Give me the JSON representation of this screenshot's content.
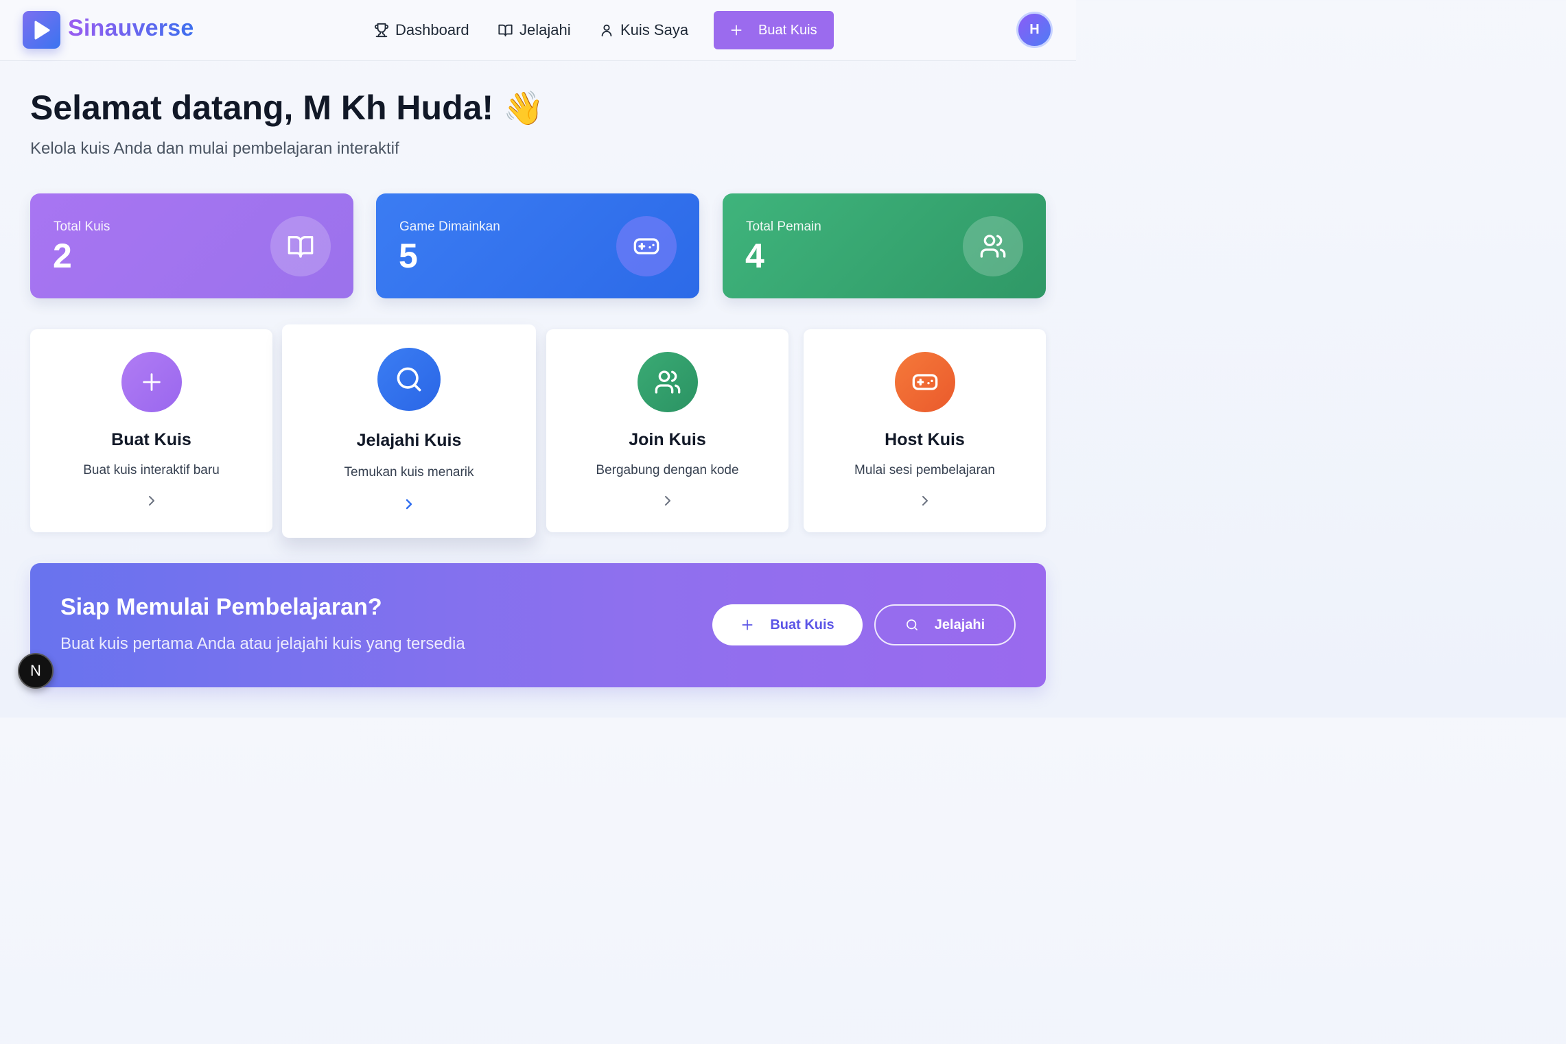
{
  "header": {
    "brand": "Sinauverse",
    "nav": [
      {
        "label": "Dashboard",
        "icon": "trophy-icon"
      },
      {
        "label": "Jelajahi",
        "icon": "book-open-icon"
      },
      {
        "label": "Kuis Saya",
        "icon": "user-icon"
      }
    ],
    "create_button": "Buat Kuis",
    "avatar_initial": "H"
  },
  "welcome": {
    "title": "Selamat datang, M Kh Huda!",
    "emoji": "👋",
    "subtitle": "Kelola kuis Anda dan mulai pembelajaran interaktif"
  },
  "stats": [
    {
      "label": "Total Kuis",
      "value": "2",
      "icon": "book-open-icon",
      "color": "#a674ef"
    },
    {
      "label": "Game Dimainkan",
      "value": "5",
      "icon": "gamepad-icon",
      "color": "#3572f0"
    },
    {
      "label": "Total Pemain",
      "value": "4",
      "icon": "users-icon",
      "color": "#37a871"
    }
  ],
  "actions": [
    {
      "title": "Buat Kuis",
      "desc": "Buat kuis interaktif baru",
      "icon": "plus-icon",
      "color": "#a26df0"
    },
    {
      "title": "Jelajahi Kuis",
      "desc": "Temukan kuis menarik",
      "icon": "search-icon",
      "color": "#2f6ef0"
    },
    {
      "title": "Join Kuis",
      "desc": "Bergabung dengan kode",
      "icon": "users-icon",
      "color": "#2f9e6b"
    },
    {
      "title": "Host Kuis",
      "desc": "Mulai sesi pembelajaran",
      "icon": "gamepad-icon",
      "color": "#f06a34"
    }
  ],
  "cta": {
    "title": "Siap Memulai Pembelajaran?",
    "subtitle": "Buat kuis pertama Anda atau jelajahi kuis yang tersedia",
    "primary_button": "Buat Kuis",
    "secondary_button": "Jelajahi"
  },
  "dev_badge": "N"
}
